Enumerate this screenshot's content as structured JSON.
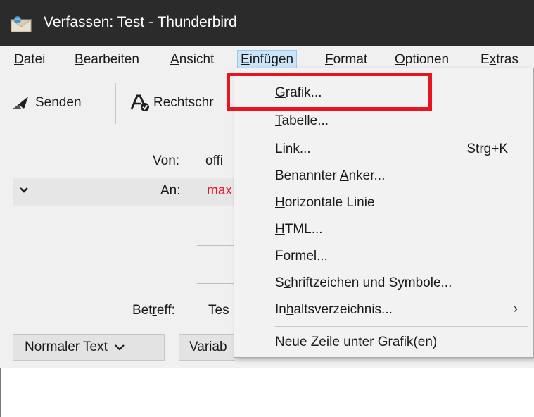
{
  "window": {
    "title": "Verfassen: Test - Thunderbird"
  },
  "menubar": {
    "items": [
      {
        "label": "Datei"
      },
      {
        "label": "Bearbeiten"
      },
      {
        "label": "Ansicht"
      },
      {
        "label": "Einfügen"
      },
      {
        "label": "Format"
      },
      {
        "label": "Optionen"
      },
      {
        "label": "Extras"
      }
    ]
  },
  "toolbar": {
    "send_label": "Senden",
    "spellcheck_label": "Rechtschr"
  },
  "headers": {
    "from_label": "Von:",
    "from_value": "offi",
    "to_label": "An:",
    "to_value": "max",
    "subject_label": "Betreff:",
    "subject_value": "Tes"
  },
  "formatbar": {
    "paragraph_format": "Normaler Text",
    "font_select": "Variab"
  },
  "insert_menu": {
    "items": [
      {
        "label": "Grafik...",
        "shortcut": ""
      },
      {
        "label": "Tabelle...",
        "shortcut": ""
      },
      {
        "label": "Link...",
        "shortcut": "Strg+K"
      },
      {
        "label": "Benannter Anker...",
        "shortcut": ""
      },
      {
        "label": "Horizontale Linie",
        "shortcut": ""
      },
      {
        "label": "HTML...",
        "shortcut": ""
      },
      {
        "label": "Formel...",
        "shortcut": ""
      },
      {
        "label": "Schriftzeichen und Symbole...",
        "shortcut": ""
      },
      {
        "label": "Inhaltsverzeichnis...",
        "shortcut": ""
      },
      {
        "label": "Neue Zeile unter Grafik(en)",
        "shortcut": ""
      }
    ],
    "submenu_arrow": "›"
  },
  "colors": {
    "titlebar": "#2b2b2b",
    "highlight": "#e8141e",
    "to_value": "#e81123"
  }
}
